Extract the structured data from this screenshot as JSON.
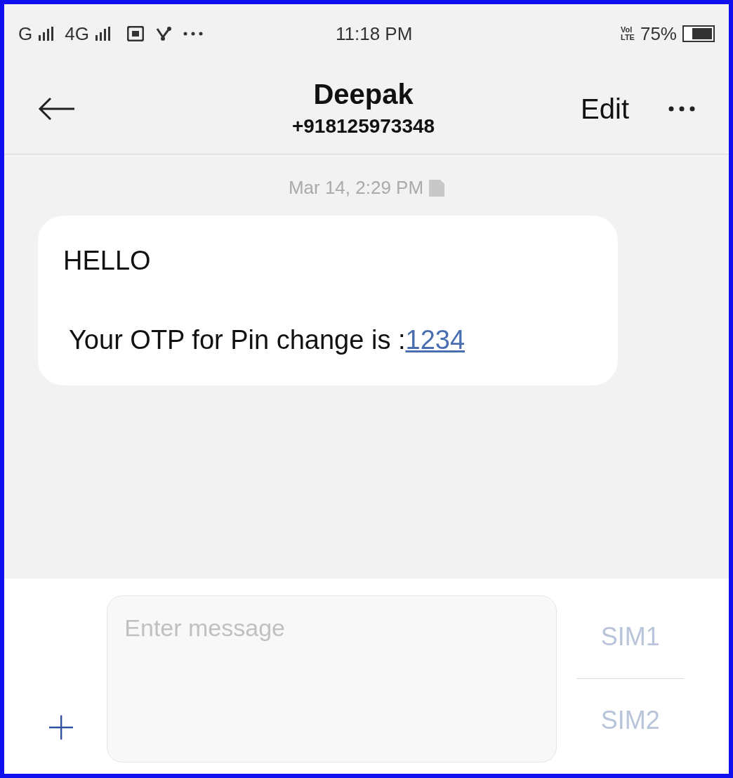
{
  "status_bar": {
    "network_1": "G",
    "network_2": "4G",
    "time": "11:18 PM",
    "volte": [
      "Vol",
      "LTE"
    ],
    "battery": "75%"
  },
  "header": {
    "name": "Deepak",
    "number": "+918125973348",
    "edit": "Edit"
  },
  "timestamp": "Mar 14, 2:29 PM",
  "message": {
    "greeting": "HELLO",
    "text": "Your OTP for Pin change is :",
    "link": "1234"
  },
  "composer": {
    "placeholder": "Enter message",
    "sims": [
      "SIM1",
      "SIM2"
    ]
  }
}
